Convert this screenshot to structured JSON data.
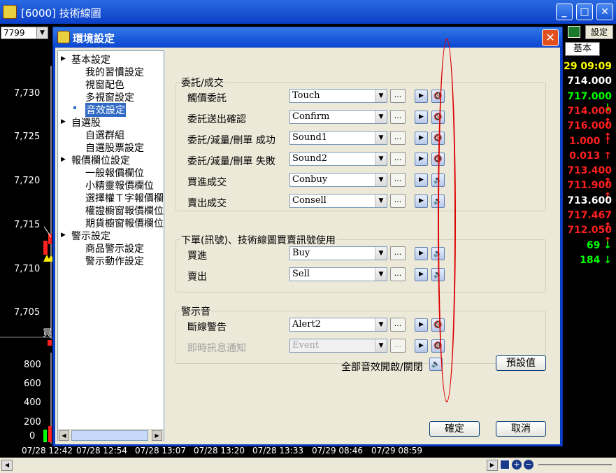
{
  "window": {
    "title": "[6000] 技術線圖"
  },
  "chart_area": {
    "symbol": "7799",
    "price_ticks": [
      "7,730",
      "7,725",
      "7,720",
      "7,715",
      "7,710",
      "7,705"
    ],
    "volume_ticks": [
      "800",
      "600",
      "400",
      "200",
      "0"
    ],
    "time_ticks": [
      "07/28 12:42",
      "07/28 12:54",
      "07/28 13:07",
      "07/28 13:20",
      "07/28 13:33",
      "07/29 08:46",
      "07/29 08:59"
    ],
    "buy_marker": "買"
  },
  "right_panel": {
    "settings_button": "設定",
    "basic_tab": "基本",
    "quotes": [
      {
        "text": "29 09:09",
        "color": "#ffff00"
      },
      {
        "text": "714.000",
        "color": "#ffffff"
      },
      {
        "text": "717.000 ↓",
        "color": "#00ff00"
      },
      {
        "text": "714.000 ↑",
        "color": "#ff2020"
      },
      {
        "text": "716.000 ↑",
        "color": "#ff2020"
      },
      {
        "text": "1.000 ↑",
        "color": "#ff2020"
      },
      {
        "text": "0.013 ↑",
        "color": "#ff2020"
      },
      {
        "text": "713.400 ↑",
        "color": "#ff2020"
      },
      {
        "text": "711.900 ↑",
        "color": "#ff2020"
      },
      {
        "text": "713.600",
        "color": "#ffffff"
      },
      {
        "text": "717.467 ↑",
        "color": "#ff2020"
      },
      {
        "text": "712.050 ↑",
        "color": "#ff2020"
      },
      {
        "text": "69 ↓",
        "color": "#00ff00"
      },
      {
        "text": "184 ↓",
        "color": "#00ff00"
      }
    ]
  },
  "dialog": {
    "title": "環境設定",
    "tree": [
      {
        "label": "基本設定",
        "level": 0,
        "arrow": "▶"
      },
      {
        "label": "我的習慣設定",
        "level": 1
      },
      {
        "label": "視窗配色",
        "level": 1
      },
      {
        "label": "多視窗設定",
        "level": 1
      },
      {
        "label": "音效設定",
        "level": 1,
        "selected": true
      },
      {
        "label": "自選股",
        "level": 0,
        "arrow": "▶"
      },
      {
        "label": "自選群組",
        "level": 1
      },
      {
        "label": "自選股票設定",
        "level": 1
      },
      {
        "label": "報價欄位設定",
        "level": 0,
        "arrow": "▶"
      },
      {
        "label": "一般報價欄位",
        "level": 1
      },
      {
        "label": "小精靈報價欄位",
        "level": 1
      },
      {
        "label": "選擇權Ｔ字報價欄",
        "level": 1
      },
      {
        "label": "權證櫥窗報價欄位",
        "level": 1
      },
      {
        "label": "期貨櫥窗報價欄位",
        "level": 1
      },
      {
        "label": "警示設定",
        "level": 0,
        "arrow": "▶"
      },
      {
        "label": "商品警示設定",
        "level": 1
      },
      {
        "label": "警示動作設定",
        "level": 1
      }
    ],
    "groups": [
      {
        "title": "委託/成交",
        "rows": [
          {
            "label": "觸價委託",
            "value": "Touch",
            "muted": true
          },
          {
            "label": "委託送出確認",
            "value": "Confirm",
            "muted": true
          },
          {
            "label": "委託/減量/刪單 成功",
            "value": "Sound1",
            "muted": true
          },
          {
            "label": "委託/減量/刪單 失敗",
            "value": "Sound2",
            "muted": true
          },
          {
            "label": "買進成交",
            "value": "Conbuy",
            "muted": false
          },
          {
            "label": "賣出成交",
            "value": "Consell",
            "muted": false
          }
        ]
      },
      {
        "title": "下單(訊號)、技術線圖買賣訊號使用",
        "rows": [
          {
            "label": "買進",
            "value": "Buy",
            "muted": false
          },
          {
            "label": "賣出",
            "value": "Sell",
            "muted": false
          }
        ]
      },
      {
        "title": "警示音",
        "rows": [
          {
            "label": "斷線警告",
            "value": "Alert2",
            "muted": true
          },
          {
            "label": "即時訊息通知",
            "value": "Event",
            "muted": true,
            "disabled": true
          }
        ]
      }
    ],
    "all_sound_label": "全部音效開啟/關閉",
    "default_button": "預設值",
    "ok_button": "確定",
    "cancel_button": "取消",
    "dots_label": "..."
  }
}
